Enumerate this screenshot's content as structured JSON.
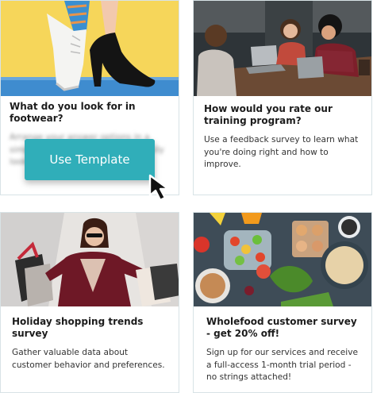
{
  "cards": [
    {
      "title": "What do you look for in footwear?",
      "description": "Arrange your answer options in a simple list so respondents can easily look & find them quickly.",
      "image_alt": "shoes-photo"
    },
    {
      "title": "How would you rate our training program?",
      "description": "Use a feedback survey to learn what you're doing right and how to improve.",
      "image_alt": "team-meeting-photo"
    },
    {
      "title": "Holiday shopping trends survey",
      "description": "Gather valuable data about customer behavior and preferences.",
      "image_alt": "shopper-with-bags-photo"
    },
    {
      "title": "Wholefood customer survey - get 20% off!",
      "description": "Sign up for our services and receive a full-access 1-month trial period - no strings attached!",
      "image_alt": "healthy-food-photo"
    }
  ],
  "use_template_label": "Use Template",
  "colors": {
    "accent": "#30aeb9",
    "card_border": "#d8e3e6"
  },
  "icons": {
    "cursor": "arrow-cursor-icon"
  }
}
